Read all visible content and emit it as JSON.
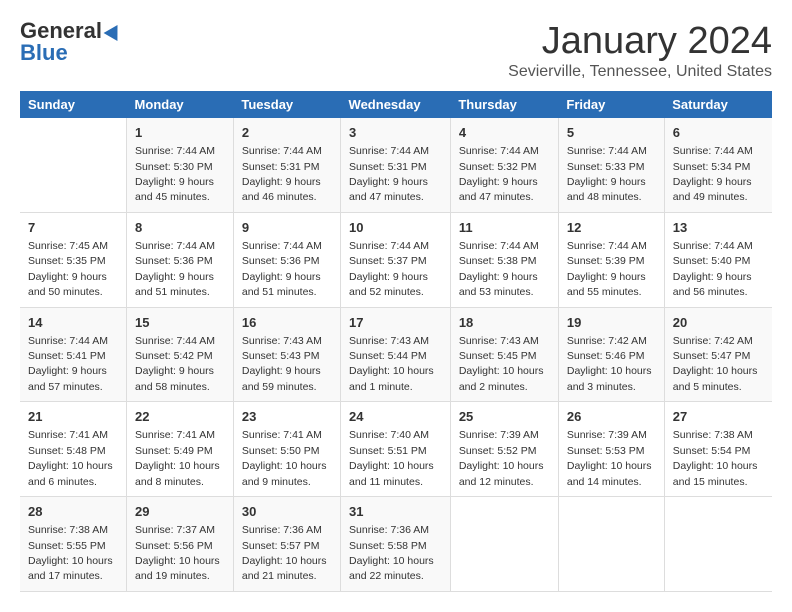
{
  "header": {
    "logo_general": "General",
    "logo_blue": "Blue",
    "title": "January 2024",
    "subtitle": "Sevierville, Tennessee, United States"
  },
  "days_of_week": [
    "Sunday",
    "Monday",
    "Tuesday",
    "Wednesday",
    "Thursday",
    "Friday",
    "Saturday"
  ],
  "weeks": [
    [
      {
        "day": "",
        "info": ""
      },
      {
        "day": "1",
        "info": "Sunrise: 7:44 AM\nSunset: 5:30 PM\nDaylight: 9 hours\nand 45 minutes."
      },
      {
        "day": "2",
        "info": "Sunrise: 7:44 AM\nSunset: 5:31 PM\nDaylight: 9 hours\nand 46 minutes."
      },
      {
        "day": "3",
        "info": "Sunrise: 7:44 AM\nSunset: 5:31 PM\nDaylight: 9 hours\nand 47 minutes."
      },
      {
        "day": "4",
        "info": "Sunrise: 7:44 AM\nSunset: 5:32 PM\nDaylight: 9 hours\nand 47 minutes."
      },
      {
        "day": "5",
        "info": "Sunrise: 7:44 AM\nSunset: 5:33 PM\nDaylight: 9 hours\nand 48 minutes."
      },
      {
        "day": "6",
        "info": "Sunrise: 7:44 AM\nSunset: 5:34 PM\nDaylight: 9 hours\nand 49 minutes."
      }
    ],
    [
      {
        "day": "7",
        "info": "Sunrise: 7:45 AM\nSunset: 5:35 PM\nDaylight: 9 hours\nand 50 minutes."
      },
      {
        "day": "8",
        "info": "Sunrise: 7:44 AM\nSunset: 5:36 PM\nDaylight: 9 hours\nand 51 minutes."
      },
      {
        "day": "9",
        "info": "Sunrise: 7:44 AM\nSunset: 5:36 PM\nDaylight: 9 hours\nand 51 minutes."
      },
      {
        "day": "10",
        "info": "Sunrise: 7:44 AM\nSunset: 5:37 PM\nDaylight: 9 hours\nand 52 minutes."
      },
      {
        "day": "11",
        "info": "Sunrise: 7:44 AM\nSunset: 5:38 PM\nDaylight: 9 hours\nand 53 minutes."
      },
      {
        "day": "12",
        "info": "Sunrise: 7:44 AM\nSunset: 5:39 PM\nDaylight: 9 hours\nand 55 minutes."
      },
      {
        "day": "13",
        "info": "Sunrise: 7:44 AM\nSunset: 5:40 PM\nDaylight: 9 hours\nand 56 minutes."
      }
    ],
    [
      {
        "day": "14",
        "info": "Sunrise: 7:44 AM\nSunset: 5:41 PM\nDaylight: 9 hours\nand 57 minutes."
      },
      {
        "day": "15",
        "info": "Sunrise: 7:44 AM\nSunset: 5:42 PM\nDaylight: 9 hours\nand 58 minutes."
      },
      {
        "day": "16",
        "info": "Sunrise: 7:43 AM\nSunset: 5:43 PM\nDaylight: 9 hours\nand 59 minutes."
      },
      {
        "day": "17",
        "info": "Sunrise: 7:43 AM\nSunset: 5:44 PM\nDaylight: 10 hours\nand 1 minute."
      },
      {
        "day": "18",
        "info": "Sunrise: 7:43 AM\nSunset: 5:45 PM\nDaylight: 10 hours\nand 2 minutes."
      },
      {
        "day": "19",
        "info": "Sunrise: 7:42 AM\nSunset: 5:46 PM\nDaylight: 10 hours\nand 3 minutes."
      },
      {
        "day": "20",
        "info": "Sunrise: 7:42 AM\nSunset: 5:47 PM\nDaylight: 10 hours\nand 5 minutes."
      }
    ],
    [
      {
        "day": "21",
        "info": "Sunrise: 7:41 AM\nSunset: 5:48 PM\nDaylight: 10 hours\nand 6 minutes."
      },
      {
        "day": "22",
        "info": "Sunrise: 7:41 AM\nSunset: 5:49 PM\nDaylight: 10 hours\nand 8 minutes."
      },
      {
        "day": "23",
        "info": "Sunrise: 7:41 AM\nSunset: 5:50 PM\nDaylight: 10 hours\nand 9 minutes."
      },
      {
        "day": "24",
        "info": "Sunrise: 7:40 AM\nSunset: 5:51 PM\nDaylight: 10 hours\nand 11 minutes."
      },
      {
        "day": "25",
        "info": "Sunrise: 7:39 AM\nSunset: 5:52 PM\nDaylight: 10 hours\nand 12 minutes."
      },
      {
        "day": "26",
        "info": "Sunrise: 7:39 AM\nSunset: 5:53 PM\nDaylight: 10 hours\nand 14 minutes."
      },
      {
        "day": "27",
        "info": "Sunrise: 7:38 AM\nSunset: 5:54 PM\nDaylight: 10 hours\nand 15 minutes."
      }
    ],
    [
      {
        "day": "28",
        "info": "Sunrise: 7:38 AM\nSunset: 5:55 PM\nDaylight: 10 hours\nand 17 minutes."
      },
      {
        "day": "29",
        "info": "Sunrise: 7:37 AM\nSunset: 5:56 PM\nDaylight: 10 hours\nand 19 minutes."
      },
      {
        "day": "30",
        "info": "Sunrise: 7:36 AM\nSunset: 5:57 PM\nDaylight: 10 hours\nand 21 minutes."
      },
      {
        "day": "31",
        "info": "Sunrise: 7:36 AM\nSunset: 5:58 PM\nDaylight: 10 hours\nand 22 minutes."
      },
      {
        "day": "",
        "info": ""
      },
      {
        "day": "",
        "info": ""
      },
      {
        "day": "",
        "info": ""
      }
    ]
  ]
}
